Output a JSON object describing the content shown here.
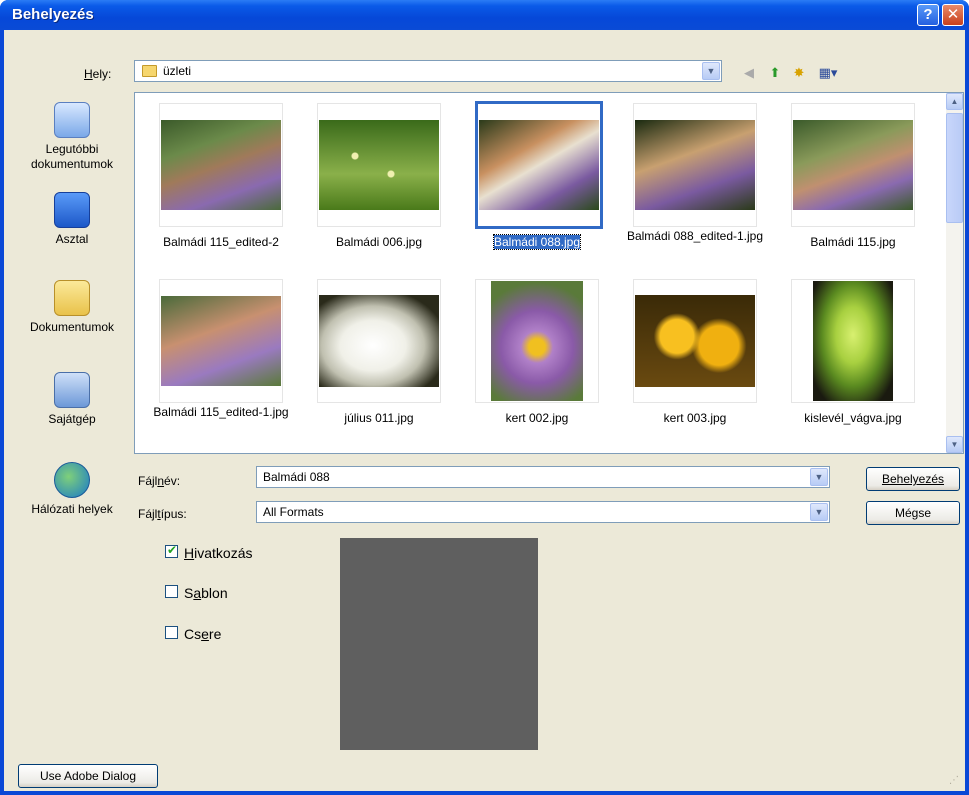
{
  "window": {
    "title": "Behelyezés",
    "help_glyph": "?",
    "close_glyph": "✕"
  },
  "location": {
    "label_pre": "",
    "label_u": "H",
    "label_post": "ely:",
    "value": "üzleti"
  },
  "places": [
    {
      "label": "Legutóbbi dokumentumok",
      "icon": "recent-documents-icon"
    },
    {
      "label": "Asztal",
      "icon": "desktop-icon"
    },
    {
      "label": "Dokumentumok",
      "icon": "documents-icon"
    },
    {
      "label": "Sajátgép",
      "icon": "my-computer-icon"
    },
    {
      "label": "Hálózati helyek",
      "icon": "network-places-icon"
    }
  ],
  "files": [
    {
      "name": "Balmádi 115_edited-2",
      "selected": false
    },
    {
      "name": "Balmádi 006.jpg",
      "selected": false
    },
    {
      "name": "Balmádi 088.jpg",
      "selected": true
    },
    {
      "name": "Balmádi 088_edited-1.jpg",
      "selected": false
    },
    {
      "name": "Balmádi 115.jpg",
      "selected": false
    },
    {
      "name": "Balmádi 115_edited-1.jpg",
      "selected": false
    },
    {
      "name": "július 011.jpg",
      "selected": false
    },
    {
      "name": "kert 002.jpg",
      "selected": false
    },
    {
      "name": "kert 003.jpg",
      "selected": false
    },
    {
      "name": "kislevél_vágva.jpg",
      "selected": false
    }
  ],
  "filename": {
    "label_pre": "Fájl",
    "label_u": "n",
    "label_post": "év:",
    "value": "Balmádi 088"
  },
  "filetype": {
    "label_pre": "Fájl",
    "label_u": "t",
    "label_post": "ípus:",
    "value": "All Formats"
  },
  "buttons": {
    "place": "Behelyezés",
    "cancel": "Mégse",
    "adobe": "Use Adobe Dialog"
  },
  "options": {
    "link": {
      "pre": "",
      "u": "H",
      "post": "ivatkozás",
      "checked": true
    },
    "template": {
      "pre": "S",
      "u": "a",
      "post": "blon",
      "checked": false
    },
    "replace": {
      "pre": "Cs",
      "u": "e",
      "post": "re",
      "checked": false
    }
  }
}
